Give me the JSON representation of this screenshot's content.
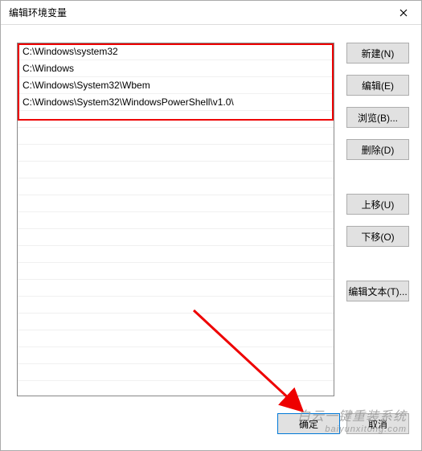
{
  "window": {
    "title": "编辑环境变量"
  },
  "paths": [
    "C:\\Windows\\system32",
    "C:\\Windows",
    "C:\\Windows\\System32\\Wbem",
    "C:\\Windows\\System32\\WindowsPowerShell\\v1.0\\"
  ],
  "buttons": {
    "new": "新建(N)",
    "edit": "编辑(E)",
    "browse": "浏览(B)...",
    "delete": "删除(D)",
    "moveup": "上移(U)",
    "movedown": "下移(O)",
    "edittext": "编辑文本(T)...",
    "ok": "确定",
    "cancel": "取消"
  },
  "watermark": "白云一键重装系统",
  "watermark_sub": "baiyunxitong.com"
}
